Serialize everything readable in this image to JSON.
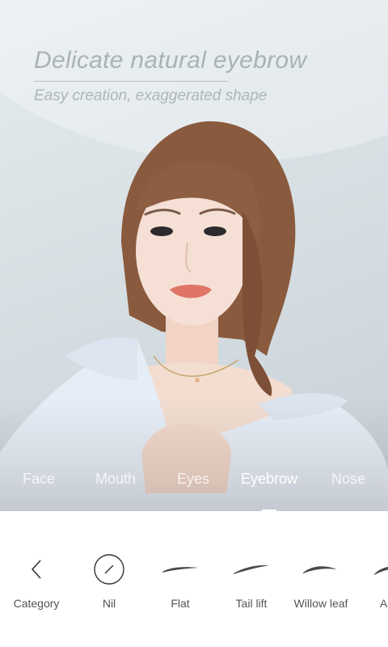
{
  "banner": {
    "headline": "Delicate natural eyebrow",
    "subline": "Easy creation, exaggerated shape"
  },
  "tabs": [
    {
      "label": "Face"
    },
    {
      "label": "Mouth"
    },
    {
      "label": "Eyes"
    },
    {
      "label": "Eyebrow",
      "active": true
    },
    {
      "label": "Nose"
    }
  ],
  "options": [
    {
      "label": "Category",
      "icon": "back-chevron-icon"
    },
    {
      "label": "Nil",
      "icon": "none-circle-icon"
    },
    {
      "label": "Flat",
      "icon": "flat-eyebrow-icon"
    },
    {
      "label": "Tail lift",
      "icon": "tail-lift-eyebrow-icon"
    },
    {
      "label": "Willow leaf",
      "icon": "willow-leaf-eyebrow-icon"
    },
    {
      "label": "Ar",
      "icon": "arched-eyebrow-icon"
    }
  ],
  "colors": {
    "panel_bg": "#ffffff",
    "tab_text": "#ffffff",
    "option_label": "#555555",
    "eyebrow_icon": "#4a4a4a"
  }
}
